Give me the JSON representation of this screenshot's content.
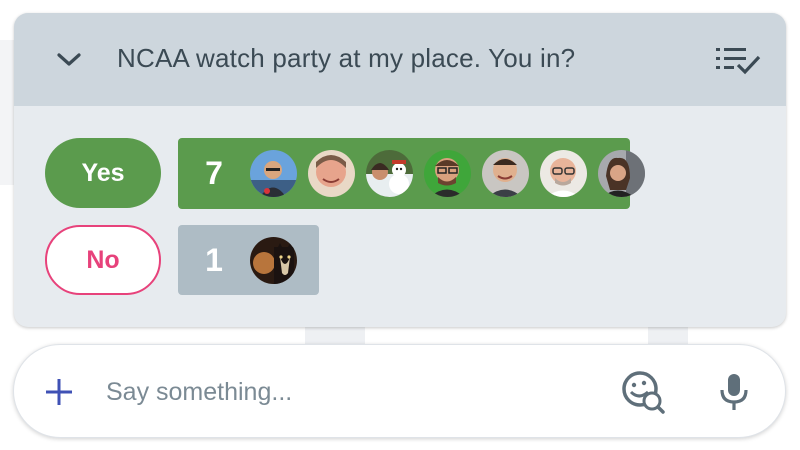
{
  "colors": {
    "header_bg": "#cdd6dd",
    "card_bg": "#e7ebef",
    "yes_green": "#5b9b4d",
    "no_pink": "#e7427b",
    "no_bar_gray": "#aebcc5",
    "text_dark": "#3b4a54",
    "accent_blue": "#3f51b5"
  },
  "poll": {
    "question": "NCAA watch party at my place. You in?",
    "collapse_icon": "chevron-down-icon",
    "list_icon": "playlist-check-icon",
    "options": [
      {
        "label": "Yes",
        "count": "7",
        "voters": [
          "voter-1",
          "voter-2",
          "voter-3",
          "voter-4",
          "voter-5",
          "voter-6",
          "voter-7"
        ]
      },
      {
        "label": "No",
        "count": "1",
        "voters": [
          "voter-8"
        ]
      }
    ]
  },
  "composer": {
    "placeholder": "Say something...",
    "add_icon": "plus-icon",
    "sticker_icon": "gif-sticker-search-icon",
    "mic_icon": "microphone-icon"
  }
}
